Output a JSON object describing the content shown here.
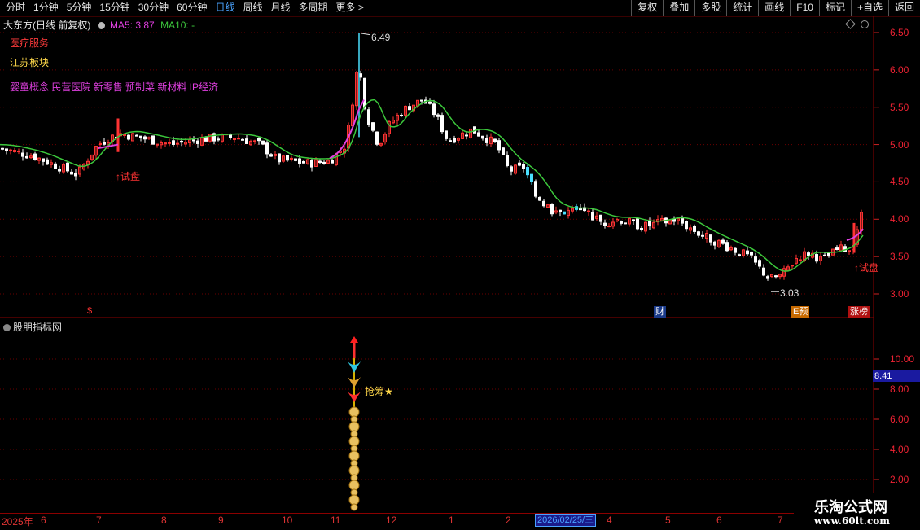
{
  "toolbar": {
    "periods": [
      "分时",
      "1分钟",
      "5分钟",
      "15分钟",
      "30分钟",
      "60分钟",
      "日线",
      "周线",
      "月线",
      "多周期",
      "更多 >"
    ],
    "active_period": "日线",
    "actions": [
      "复权",
      "叠加",
      "多股",
      "统计",
      "画线",
      "F10",
      "标记",
      "+自选",
      "返回"
    ]
  },
  "header": {
    "stock_title": "大东方(日线 前复权)",
    "ma5_label": "MA5: 3.87",
    "ma10_label": "MA10: -",
    "diamond_icon": "diamond-icon",
    "gear_icon": "gear-icon"
  },
  "tags": {
    "sector1": "医疗服务",
    "sector2": "江苏板块",
    "concepts": "婴童概念 民营医院 新零售 预制菜 新材料 IP经济"
  },
  "annotations": {
    "high_price": "6.49",
    "low_price": "3.03",
    "trial1": "↑试盘",
    "trial2": "↑试盘",
    "s_marker": "$",
    "badge_cai": "财",
    "badge_yu": "E预",
    "badge_zhangting": "涨榜"
  },
  "y_axis_main": [
    "6.50",
    "6.00",
    "5.50",
    "5.00",
    "4.50",
    "4.00",
    "3.50",
    "3.00"
  ],
  "indicator": {
    "title": "股朋指标网",
    "label": "抢筹★",
    "current_value": "8.41",
    "y_axis": [
      "10.00",
      "8.00",
      "6.00",
      "4.00",
      "2.00"
    ]
  },
  "date_axis": {
    "year_label": "2025年",
    "months": [
      "6",
      "7",
      "8",
      "9",
      "10",
      "11",
      "12",
      "1",
      "2",
      "3",
      "4",
      "5",
      "6",
      "7"
    ],
    "cursor_date": "2026/02/25/三"
  },
  "watermark": {
    "line1": "乐淘公式网",
    "line2": "www.60lt.com"
  },
  "colors": {
    "up": "#ff3333",
    "down": "#ffffff",
    "ma_line": "#3cc83c",
    "accent": "#4aa3ff",
    "magenta": "#e040e0"
  }
}
